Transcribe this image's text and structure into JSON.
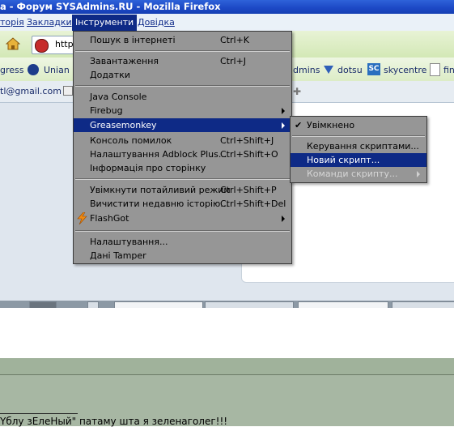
{
  "window": {
    "title": "а - Форум SYSAdmins.RU - Mozilla Firefox"
  },
  "menubar": {
    "items": [
      "торія",
      "Закладки",
      "Інструменти",
      "Довідка"
    ]
  },
  "navbar": {
    "url_fragment": "http"
  },
  "bookmarks": {
    "items": [
      "gress",
      "Unian",
      "dmins",
      "dotsu",
      "skycentre",
      "fin"
    ],
    "skycentre_icon_text": "SC"
  },
  "tabbar": {
    "email": "tl@gmail.com"
  },
  "tools_menu": {
    "items": [
      {
        "label": "Пошук в інтернеті",
        "shortcut": "Ctrl+K"
      },
      {
        "label": "Завантаження",
        "shortcut": "Ctrl+J"
      },
      {
        "label": "Додатки",
        "shortcut": ""
      },
      {
        "label": "Java Console",
        "shortcut": ""
      },
      {
        "label": "Firebug",
        "shortcut": ""
      },
      {
        "label": "Greasemonkey",
        "shortcut": ""
      },
      {
        "label": "Консоль помилок",
        "shortcut": "Ctrl+Shift+J"
      },
      {
        "label": "Налаштування Adblock Plus...",
        "shortcut": "Ctrl+Shift+O"
      },
      {
        "label": "Інформація про сторінку",
        "shortcut": ""
      },
      {
        "label": "Увімкнути потайливий режим",
        "shortcut": "Ctrl+Shift+P"
      },
      {
        "label": "Вичистити недавню історію...",
        "shortcut": "Ctrl+Shift+Del"
      },
      {
        "label": "FlashGot",
        "shortcut": ""
      },
      {
        "label": "Налаштування...",
        "shortcut": ""
      },
      {
        "label": "Дані Tamper",
        "shortcut": ""
      }
    ]
  },
  "gm_submenu": {
    "items": [
      {
        "label": "Увімкнено",
        "checked": true
      },
      {
        "label": "Керування скриптами...",
        "checked": false
      },
      {
        "label": "Новий скрипт...",
        "checked": false
      },
      {
        "label": "Команди скрипту...",
        "checked": false
      }
    ]
  },
  "page": {
    "bottom_text": "Yблу зЕлеНый\" патаму шта я зеленаголег!!!"
  },
  "colors": {
    "highlight": "#0e2a86",
    "menu_bg": "#969696"
  }
}
